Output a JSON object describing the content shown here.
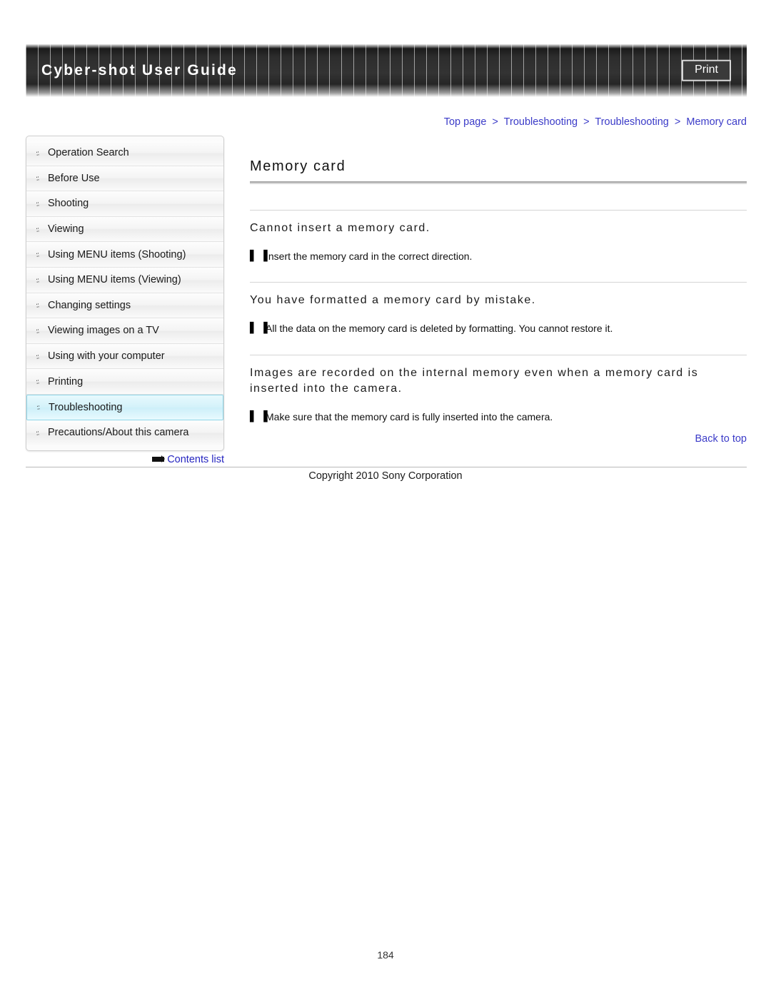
{
  "header": {
    "title": "Cyber-shot User Guide",
    "print_label": "Print"
  },
  "breadcrumb": {
    "separator": ">",
    "items": [
      {
        "label": "Top page"
      },
      {
        "label": "Troubleshooting"
      },
      {
        "label": "Troubleshooting"
      },
      {
        "label": "Memory card"
      }
    ]
  },
  "sidebar": {
    "bullet_glyph": "::",
    "items": [
      {
        "label": "Operation Search",
        "active": false
      },
      {
        "label": "Before Use",
        "active": false
      },
      {
        "label": "Shooting",
        "active": false
      },
      {
        "label": "Viewing",
        "active": false
      },
      {
        "label": "Using MENU items (Shooting)",
        "active": false
      },
      {
        "label": "Using MENU items (Viewing)",
        "active": false
      },
      {
        "label": "Changing settings",
        "active": false
      },
      {
        "label": "Viewing images on a TV",
        "active": false
      },
      {
        "label": "Using with your computer",
        "active": false
      },
      {
        "label": "Printing",
        "active": false
      },
      {
        "label": "Troubleshooting",
        "active": true
      },
      {
        "label": "Precautions/About this camera",
        "active": false
      }
    ],
    "contents_link": "Contents list"
  },
  "main": {
    "title": "Memory card",
    "bullet_glyph": "▌▐",
    "sections": [
      {
        "heading": "Cannot insert a memory card.",
        "body": "Insert the memory card in the correct direction."
      },
      {
        "heading": "You have formatted a memory card by mistake.",
        "body": "All the data on the memory card is deleted by formatting. You cannot restore it."
      },
      {
        "heading": "Images are recorded on the internal memory even when a memory card is inserted into the camera.",
        "body": "Make sure that the memory card is fully inserted into the camera."
      }
    ],
    "back_to_top": "Back to top"
  },
  "footer": {
    "copyright": "Copyright 2010 Sony Corporation",
    "page_number": "184"
  },
  "colors": {
    "link": "#3b3bc8",
    "highlight": "#d4f2fa",
    "header_dark": "#2d2d2d"
  }
}
